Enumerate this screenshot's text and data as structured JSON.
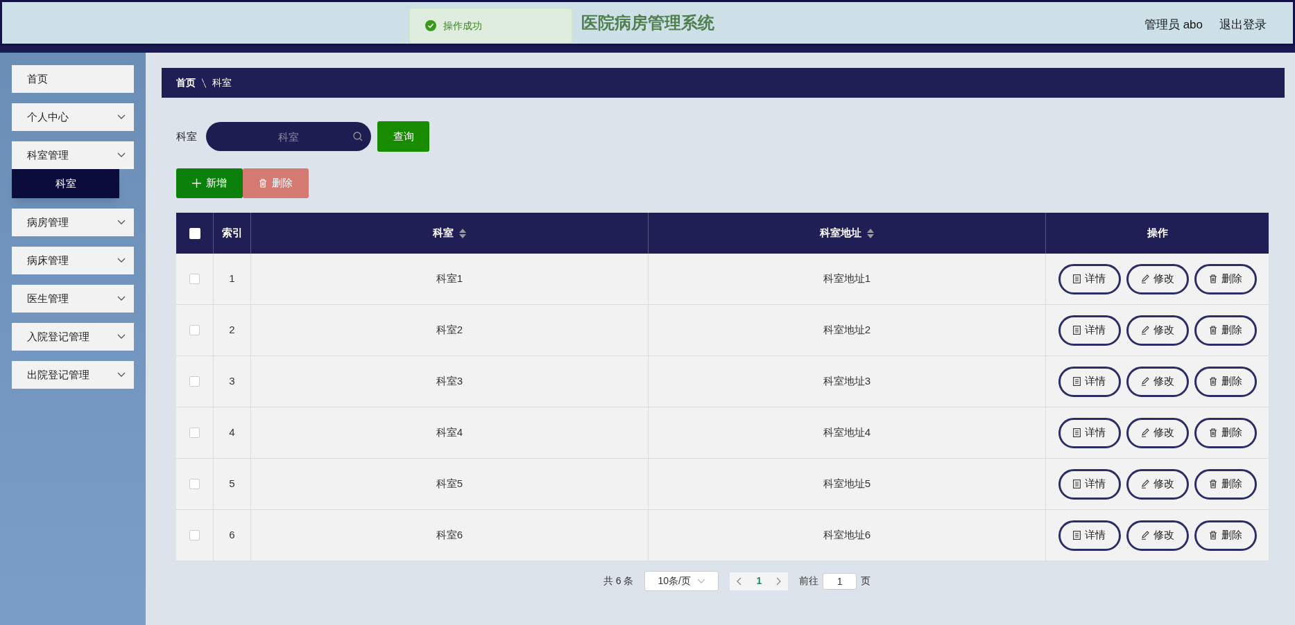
{
  "header": {
    "title": "医院病房管理系统",
    "user": "管理员 abo",
    "logout": "退出登录"
  },
  "toast": {
    "message": "操作成功"
  },
  "sidebar": {
    "items": [
      {
        "label": "首页",
        "expandable": false
      },
      {
        "label": "个人中心",
        "expandable": true
      },
      {
        "label": "科室管理",
        "expandable": true,
        "children": [
          {
            "label": "科室",
            "selected": true
          }
        ]
      },
      {
        "label": "病房管理",
        "expandable": true
      },
      {
        "label": "病床管理",
        "expandable": true
      },
      {
        "label": "医生管理",
        "expandable": true
      },
      {
        "label": "入院登记管理",
        "expandable": true
      },
      {
        "label": "出院登记管理",
        "expandable": true
      }
    ]
  },
  "breadcrumb": [
    "首页",
    "科室"
  ],
  "search": {
    "label": "科室",
    "placeholder": "科室",
    "button": "查询"
  },
  "actions": {
    "add": "新增",
    "delete": "删除"
  },
  "table": {
    "select_all": false,
    "columns": [
      {
        "label": "索引",
        "sortable": false
      },
      {
        "label": "科室",
        "sortable": true
      },
      {
        "label": "科室地址",
        "sortable": true
      },
      {
        "label": "操作",
        "sortable": false
      }
    ],
    "rows": [
      {
        "checked": false,
        "index": "1",
        "name": "科室1",
        "address": "科室地址1",
        "buttons": [
          "详情",
          "修改",
          "删除"
        ]
      },
      {
        "checked": false,
        "index": "2",
        "name": "科室2",
        "address": "科室地址2",
        "buttons": [
          "详情",
          "修改",
          "删除"
        ]
      },
      {
        "checked": false,
        "index": "3",
        "name": "科室3",
        "address": "科室地址3",
        "buttons": [
          "详情",
          "修改",
          "删除"
        ]
      },
      {
        "checked": false,
        "index": "4",
        "name": "科室4",
        "address": "科室地址4",
        "buttons": [
          "详情",
          "修改",
          "删除"
        ]
      },
      {
        "checked": false,
        "index": "5",
        "name": "科室5",
        "address": "科室地址5",
        "buttons": [
          "详情",
          "修改",
          "删除"
        ]
      },
      {
        "checked": false,
        "index": "6",
        "name": "科室6",
        "address": "科室地址6",
        "buttons": [
          "详情",
          "修改",
          "删除"
        ]
      }
    ]
  },
  "pagination": {
    "total": "共 6 条",
    "page_size": "10条/页",
    "pages": [
      {
        "label": "1",
        "selected": true
      }
    ],
    "goto_label": "前往",
    "goto_value": "1",
    "goto_suffix": "页"
  }
}
